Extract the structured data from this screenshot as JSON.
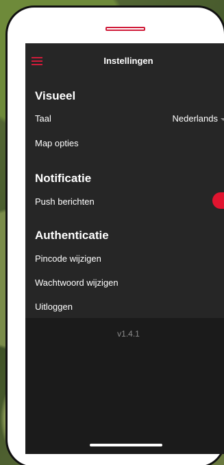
{
  "header": {
    "title": "Instellingen"
  },
  "sections": {
    "visueel": {
      "title": "Visueel",
      "taal_label": "Taal",
      "taal_value": "Nederlands",
      "map_options_label": "Map opties"
    },
    "notificatie": {
      "title": "Notificatie",
      "push_label": "Push berichten",
      "push_enabled": true
    },
    "authenticatie": {
      "title": "Authenticatie",
      "pincode_label": "Pincode wijzigen",
      "password_label": "Wachtwoord wijzigen",
      "logout_label": "Uitloggen"
    }
  },
  "footer": {
    "version": "v1.4.1"
  },
  "colors": {
    "accent": "#e0142f",
    "background": "#1b1b1b",
    "panel": "#262626"
  },
  "icons": {
    "menu": "hamburger-icon",
    "dropdown": "caret-down-icon"
  }
}
